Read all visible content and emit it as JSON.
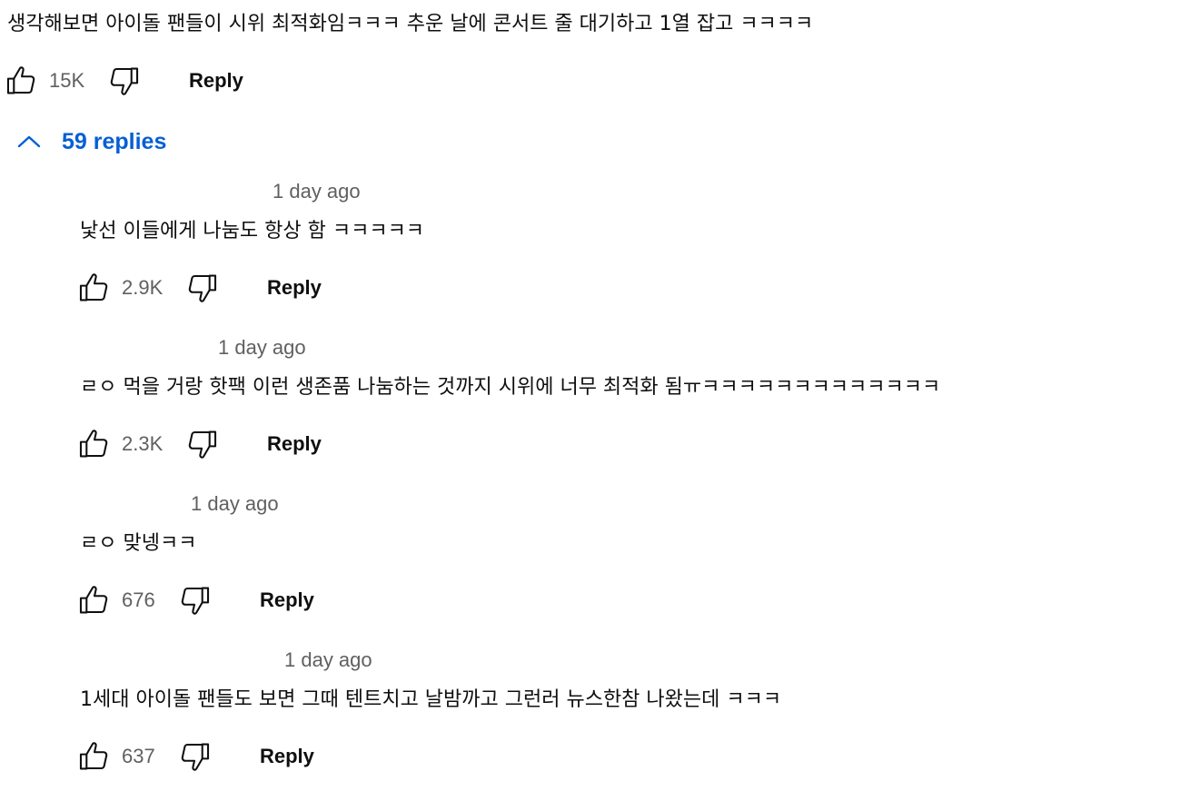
{
  "top_comment": {
    "text": "생각해보면 아이돌 팬들이 시위 최적화임ㅋㅋㅋ 추운 날에 콘서트 줄 대기하고 1열 잡고 ㅋㅋㅋㅋ",
    "likes": "15K",
    "reply_label": "Reply"
  },
  "replies_toggle": {
    "label": "59 replies",
    "icon": "chevron-up-icon",
    "color": "#065fd4"
  },
  "replies": [
    {
      "timestamp": "1 day ago",
      "text": "낯선 이들에게 나눔도 항상 함 ㅋㅋㅋㅋㅋ",
      "likes": "2.9K",
      "reply_label": "Reply"
    },
    {
      "timestamp": "1 day ago",
      "text": "ㄹㅇ 먹을 거랑 핫팩 이런 생존품 나눔하는 것까지 시위에 너무 최적화 됨ㅠㅋㅋㅋㅋㅋㅋㅋㅋㅋㅋㅋㅋㅋ",
      "likes": "2.3K",
      "reply_label": "Reply"
    },
    {
      "timestamp": "1 day ago",
      "text": "ㄹㅇ 맞넹ㅋㅋ",
      "likes": "676",
      "reply_label": "Reply"
    },
    {
      "timestamp": "1 day ago",
      "text": "1세대 아이돌 팬들도 보면 그때 텐트치고 날밤까고 그런러 뉴스한참 나왔는데 ㅋㅋㅋ",
      "likes": "637",
      "reply_label": "Reply"
    }
  ],
  "icons": {
    "like": "thumbs-up-icon",
    "dislike": "thumbs-down-icon"
  },
  "colors": {
    "text": "#0f0f0f",
    "secondary": "#606060",
    "link": "#065fd4"
  }
}
